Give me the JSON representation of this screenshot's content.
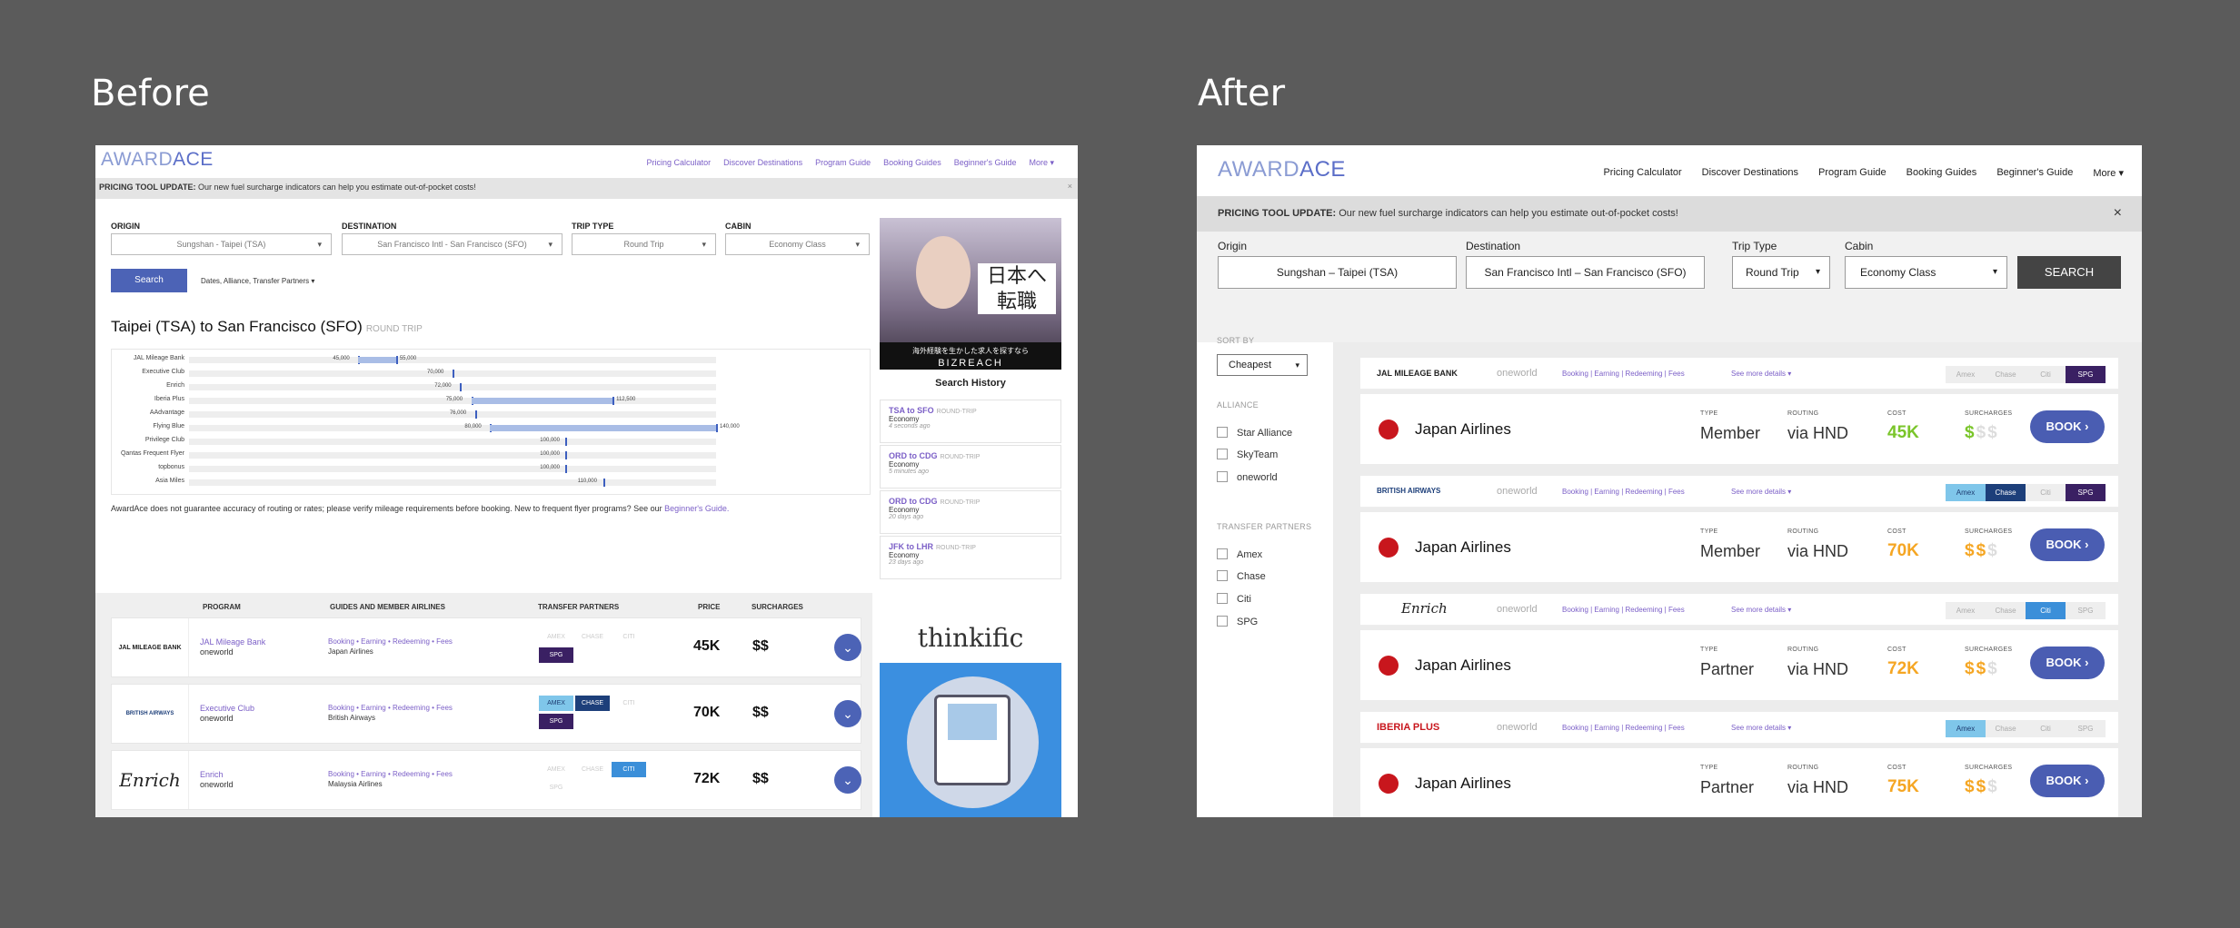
{
  "labels": {
    "before": "Before",
    "after": "After"
  },
  "before": {
    "logo": {
      "a": "AWARD",
      "b": "ACE"
    },
    "nav": [
      "Pricing Calculator",
      "Discover Destinations",
      "Program Guide",
      "Booking Guides",
      "Beginner's Guide",
      "More ▾"
    ],
    "banner": {
      "bold": "PRICING TOOL UPDATE:",
      "text": " Our new fuel surcharge indicators can help you estimate out-of-pocket costs!"
    },
    "close": "×",
    "form": {
      "origin_label": "ORIGIN",
      "origin": "Sungshan - Taipei (TSA)",
      "dest_label": "DESTINATION",
      "dest": "San Francisco Intl - San Francisco (SFO)",
      "trip_label": "TRIP TYPE",
      "trip": "Round Trip",
      "cabin_label": "CABIN",
      "cabin": "Economy Class",
      "search": "Search",
      "filters": "Dates, Alliance, Transfer Partners ▾"
    },
    "route_title": "Taipei (TSA) to San Francisco (SFO)",
    "route_type": "ROUND TRIP",
    "disclaimer": "AwardAce does not guarantee accuracy of routing or rates; please verify mileage requirements before booking. New to frequent flyer programs? See our ",
    "disclaimer_link": "Beginner's Guide.",
    "history_title": "Search History",
    "history": [
      {
        "route": "TSA to SFO",
        "type": "ROUND-TRIP",
        "cabin": "Economy",
        "time": "4 seconds ago"
      },
      {
        "route": "ORD to CDG",
        "type": "ROUND-TRIP",
        "cabin": "Economy",
        "time": "5 minutes ago"
      },
      {
        "route": "ORD to CDG",
        "type": "ROUND-TRIP",
        "cabin": "Economy",
        "time": "20 days ago"
      },
      {
        "route": "JFK to LHR",
        "type": "ROUND-TRIP",
        "cabin": "Economy",
        "time": "23 days ago"
      }
    ],
    "ad1": {
      "jp": "日本へ転職",
      "sub": "海外経験を生かした求人を探すなら",
      "brand": "BIZREACH"
    },
    "ad2": {
      "brand": "thinkific"
    },
    "table_headers": [
      "PROGRAM",
      "GUIDES AND MEMBER AIRLINES",
      "TRANSFER PARTNERS",
      "PRICE",
      "SURCHARGES"
    ],
    "rows": [
      {
        "logo": "JAL MILEAGE BANK",
        "program": "JAL Mileage Bank",
        "alliance": "oneworld",
        "guides": "Booking • Earning • Redeeming • Fees",
        "airline": "Japan Airlines",
        "price": "45K",
        "sur": "$$",
        "chips": [
          "AMEX",
          "CHASE",
          "CITI",
          "SPG"
        ]
      },
      {
        "logo": "BRITISH AIRWAYS",
        "program": "Executive Club",
        "alliance": "oneworld",
        "guides": "Booking • Earning • Redeeming • Fees",
        "airline": "British Airways",
        "price": "70K",
        "sur": "$$",
        "chips": [
          "AMEX",
          "CHASE",
          "CITI",
          "SPG"
        ]
      },
      {
        "logo": "Enrich",
        "program": "Enrich",
        "alliance": "oneworld",
        "guides": "Booking • Earning • Redeeming • Fees",
        "airline": "Malaysia Airlines",
        "price": "72K",
        "sur": "$$",
        "chips": [
          "AMEX",
          "CHASE",
          "CITI",
          "SPG"
        ]
      }
    ]
  },
  "after": {
    "logo": {
      "a": "AWARD",
      "b": "ACE"
    },
    "nav": [
      "Pricing Calculator",
      "Discover Destinations",
      "Program Guide",
      "Booking Guides",
      "Beginner's Guide",
      "More ▾"
    ],
    "banner": {
      "bold": "PRICING TOOL UPDATE:",
      "text": " Our new fuel surcharge indicators can help you estimate out-of-pocket costs!"
    },
    "close": "×",
    "form": {
      "origin_label": "Origin",
      "origin": "Sungshan – Taipei (TSA)",
      "dest_label": "Destination",
      "dest": "San Francisco Intl – San Francisco (SFO)",
      "trip_label": "Trip Type",
      "trip": "Round Trip",
      "cabin_label": "Cabin",
      "cabin": "Economy Class",
      "search": "SEARCH"
    },
    "sort_label": "SORT BY",
    "sort": "Cheapest",
    "alliance_label": "ALLIANCE",
    "alliances": [
      "Star Alliance",
      "SkyTeam",
      "oneworld"
    ],
    "partners_label": "TRANSFER PARTNERS",
    "partners": [
      "Amex",
      "Chase",
      "Citi",
      "SPG"
    ],
    "cards": [
      {
        "program": "JAL MILEAGE BANK",
        "alliance": "oneworld",
        "links": "Booking | Earning | Redeeming | Fees",
        "more": "See more details ▾",
        "airline": "Japan Airlines",
        "type_k": "TYPE",
        "type": "Member",
        "routing_k": "ROUTING",
        "routing": "via HND",
        "cost_k": "COST",
        "cost": "45K",
        "cost_color": "#7ac52a",
        "sur_k": "SURCHARGES",
        "sur_on": "$",
        "sur_off": "$$",
        "book": "BOOK ›"
      },
      {
        "program": "BRITISH AIRWAYS",
        "alliance": "oneworld",
        "links": "Booking | Earning | Redeeming | Fees",
        "more": "See more details ▾",
        "airline": "Japan Airlines",
        "type_k": "TYPE",
        "type": "Member",
        "routing_k": "ROUTING",
        "routing": "via HND",
        "cost_k": "COST",
        "cost": "70K",
        "cost_color": "#f5a623",
        "sur_k": "SURCHARGES",
        "sur_on": "$$",
        "sur_off": "$",
        "book": "BOOK ›"
      },
      {
        "program": "Enrich",
        "alliance": "oneworld",
        "links": "Booking | Earning | Redeeming | Fees",
        "more": "See more details ▾",
        "airline": "Japan Airlines",
        "type_k": "TYPE",
        "type": "Partner",
        "routing_k": "ROUTING",
        "routing": "via HND",
        "cost_k": "COST",
        "cost": "72K",
        "cost_color": "#f5a623",
        "sur_k": "SURCHARGES",
        "sur_on": "$$",
        "sur_off": "$",
        "book": "BOOK ›"
      },
      {
        "program": "IBERIA PLUS",
        "alliance": "oneworld",
        "links": "Booking | Earning | Redeeming | Fees",
        "more": "See more details ▾",
        "airline": "Japan Airlines",
        "type_k": "TYPE",
        "type": "Partner",
        "routing_k": "ROUTING",
        "routing": "via HND",
        "cost_k": "COST",
        "cost": "75K",
        "cost_color": "#f5a623",
        "sur_k": "SURCHARGES",
        "sur_on": "$$",
        "sur_off": "$",
        "book": "BOOK ›"
      }
    ]
  },
  "chart_data": {
    "type": "bar",
    "categories": [
      "JAL Mileage Bank",
      "Executive Club",
      "Enrich",
      "Iberia Plus",
      "AAdvantage",
      "Flying Blue",
      "Privilege Club",
      "Qantas Frequent Flyer",
      "topbonus",
      "Asia Miles"
    ],
    "series": [
      {
        "values": [
          45000,
          70000,
          72000,
          75000,
          76000,
          80000,
          100000,
          100000,
          100000,
          110000
        ]
      },
      {
        "values": [
          55000,
          null,
          null,
          112500,
          null,
          140000,
          null,
          null,
          null,
          null
        ]
      }
    ],
    "value_labels": [
      [
        "45,000",
        "55,000"
      ],
      [
        "70,000",
        ""
      ],
      [
        "72,000",
        ""
      ],
      [
        "75,000",
        "112,500"
      ],
      [
        "76,000",
        ""
      ],
      [
        "80,000",
        "140,000"
      ],
      [
        "100,000",
        ""
      ],
      [
        "100,000",
        ""
      ],
      [
        "100,000",
        ""
      ],
      [
        "110,000",
        ""
      ]
    ],
    "xlim": [
      0,
      140000
    ]
  }
}
